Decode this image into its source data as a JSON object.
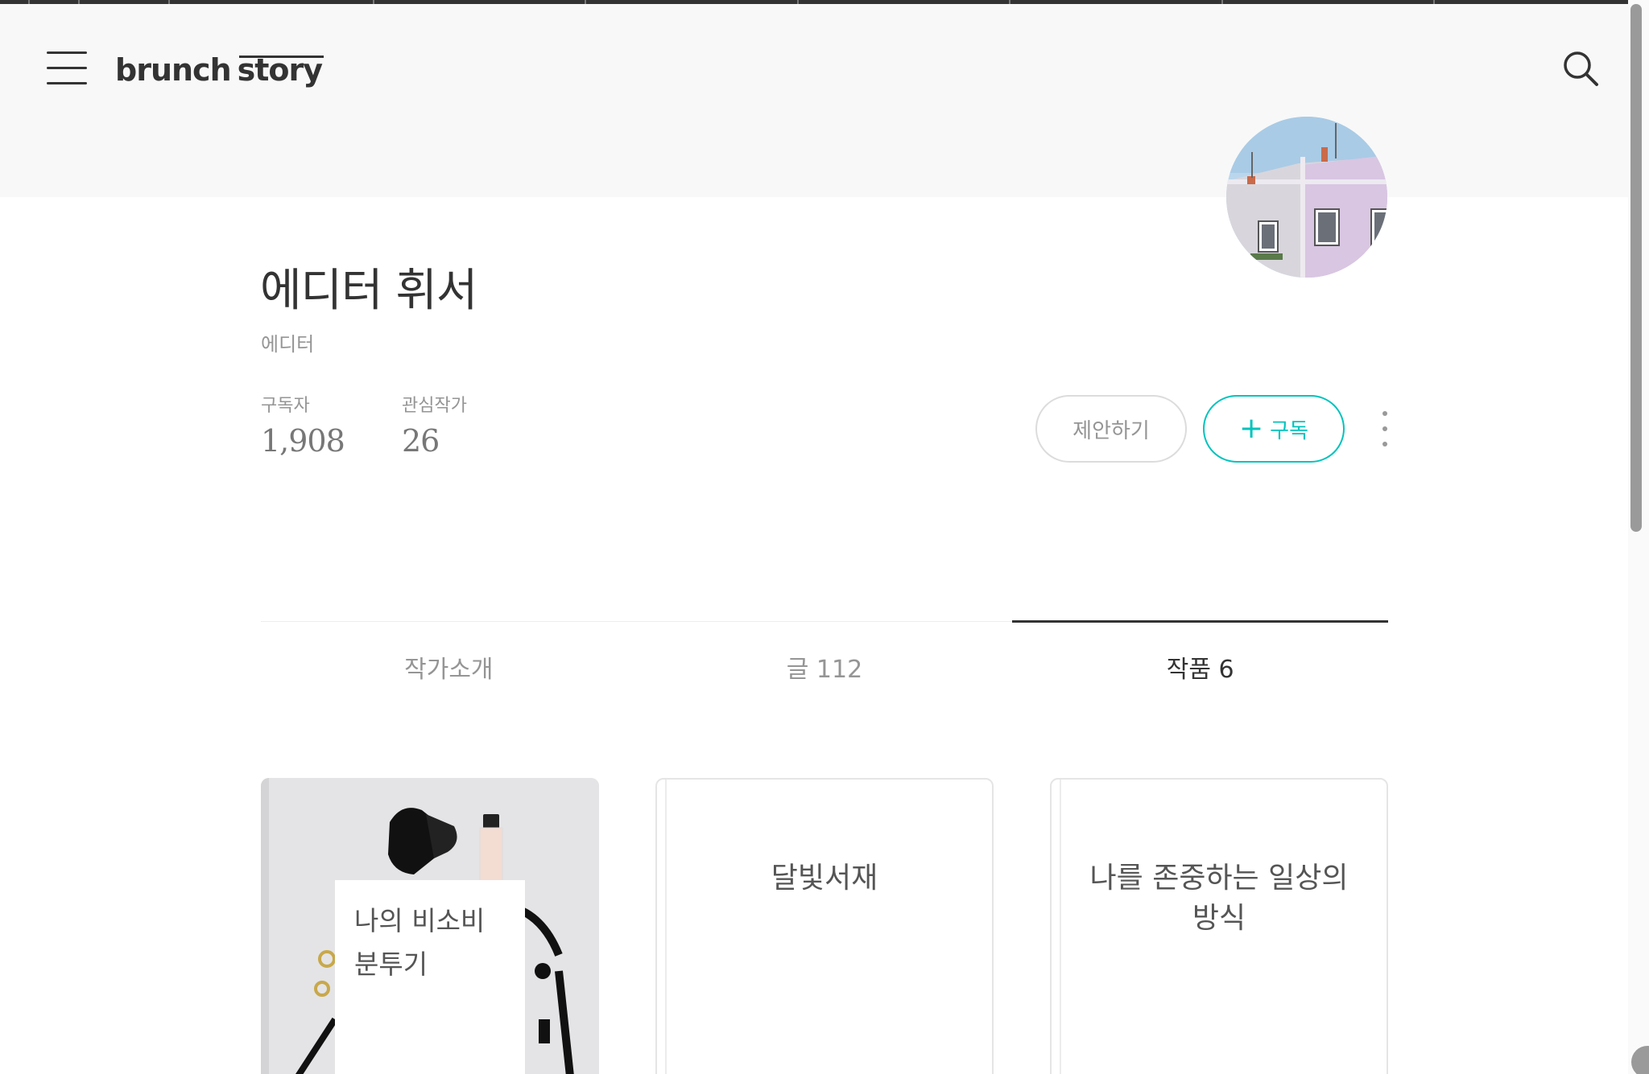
{
  "header": {
    "logo_word1": "brunch",
    "logo_word2": "story"
  },
  "author": {
    "name": "에디터 휘서",
    "role": "에디터",
    "stats": {
      "subscribers_label": "구독자",
      "subscribers_value": "1,908",
      "favorites_label": "관심작가",
      "favorites_value": "26"
    },
    "suggest_label": "제안하기",
    "subscribe_plus": "+",
    "subscribe_label": "구독"
  },
  "tabs": [
    {
      "label": "작가소개",
      "active": false
    },
    {
      "label": "글 112",
      "active": false
    },
    {
      "label": "작품 6",
      "active": true
    }
  ],
  "books": [
    {
      "title": "나의 비소비 분투기"
    },
    {
      "title": "달빛서재"
    },
    {
      "title": "나를 존중하는 일상의 방식"
    }
  ],
  "colors": {
    "accent": "#00c3bd",
    "header_bg": "#f8f8f8",
    "text_primary": "#333333",
    "text_muted": "#959595"
  },
  "icons": {
    "menu": "hamburger-menu-icon",
    "search": "search-icon",
    "more": "more-vertical-icon"
  }
}
